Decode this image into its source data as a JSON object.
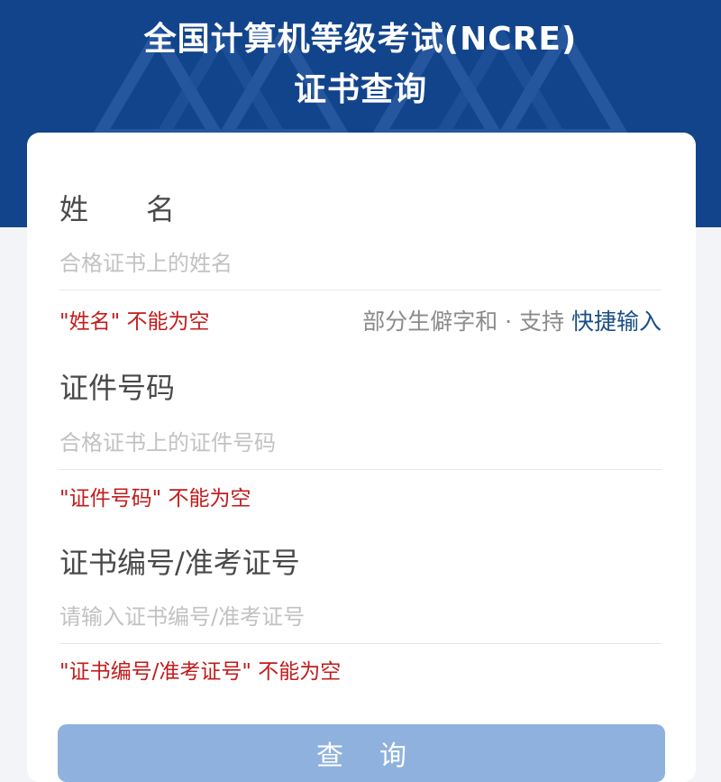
{
  "header": {
    "title_line1": "全国计算机等级考试(NCRE)",
    "title_line2": "证书查询",
    "bg_color": "#12448c"
  },
  "form": {
    "name": {
      "label": "姓　　名",
      "placeholder": "合格证书上的姓名",
      "error": "\"姓名\" 不能为空",
      "hint_text": "部分生僻字和 · 支持 ",
      "hint_link": "快捷输入"
    },
    "id_number": {
      "label": "证件号码",
      "placeholder": "合格证书上的证件号码",
      "error": "\"证件号码\" 不能为空"
    },
    "cert_number": {
      "label": "证书编号/准考证号",
      "placeholder": "请输入证书编号/准考证号",
      "error": "\"证书编号/准考证号\" 不能为空"
    },
    "submit_label": "查询"
  },
  "colors": {
    "error": "#c21c1c",
    "link": "#1b4f86",
    "button": "#8fb1dd"
  }
}
